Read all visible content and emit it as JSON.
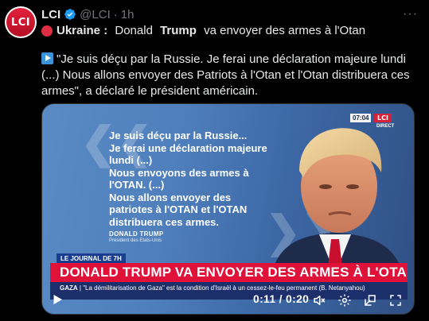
{
  "tweet": {
    "avatar_text": "LCI",
    "name": "LCI",
    "handle": "@LCI",
    "separator": "·",
    "time": "1h",
    "more": "···",
    "headline_prefix": "Ukraine :",
    "headline_rest": " Donald ",
    "headline_bold": "Trump",
    "headline_tail": " va envoyer des armes à l'Otan",
    "body": "\"Je suis déçu par la Russie. Je ferai une déclaration majeure lundi (...) Nous allons envoyer des Patriots à l'Otan et l'Otan distribuera ces armes\", a déclaré le président américain."
  },
  "video": {
    "quote_lines": [
      "Je suis déçu par la Russie...",
      "Je ferai une déclaration majeure",
      "lundi (...)",
      "Nous envoyons des armes à",
      "l'OTAN. (...)",
      "Nous allons envoyer des",
      "patriotes à l'OTAN et l'OTAN",
      "distribuera ces armes."
    ],
    "attribution_name": "DONALD TRUMP",
    "attribution_role": "Président des États-Unis",
    "badge_time": "07:04",
    "badge_logo": "LCI",
    "badge_direct": "DIRECT",
    "journal_tag": "LE JOURNAL DE 7H",
    "headline": "DONALD TRUMP VA ENVOYER DES ARMES À L'OTAN",
    "ticker_label": "GAZA",
    "ticker_text": " | \"La démilitarisation de Gaza\" est la condition d'Israël à un cessez-le-feu permanent (B. Netanyahou)",
    "time_readout": "0:11 / 0:20"
  },
  "colors": {
    "accent_red": "#e0123a",
    "verified_blue": "#1d9bf0",
    "ticker_blue": "#1d2f6b"
  },
  "icons": [
    "verified-badge-icon",
    "more-icon",
    "play-icon",
    "mute-icon",
    "settings-icon",
    "popout-icon",
    "fullscreen-icon"
  ]
}
